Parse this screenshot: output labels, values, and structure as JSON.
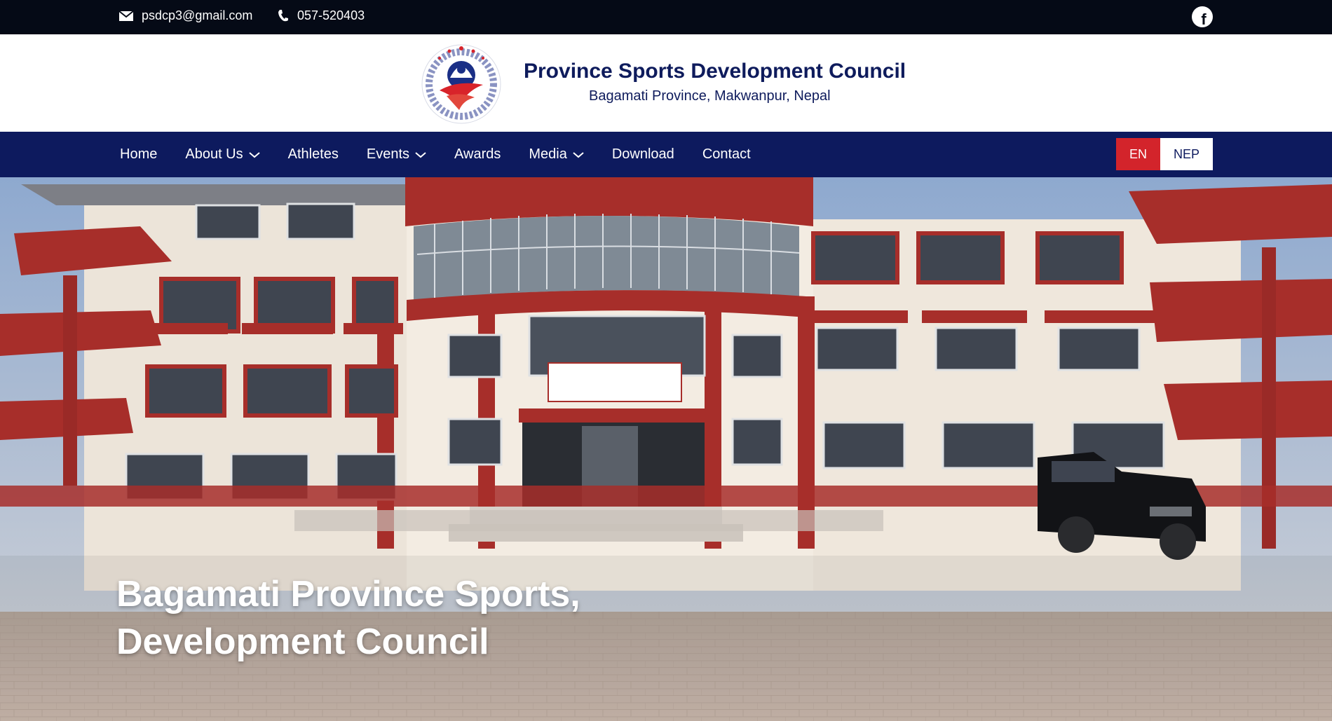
{
  "topbar": {
    "email": "psdcp3@gmail.com",
    "phone": "057-520403",
    "social_icon": "facebook-icon"
  },
  "header": {
    "logo_icon": "council-emblem",
    "title": "Province Sports Development Council",
    "subtitle": "Bagamati Province, Makwanpur, Nepal"
  },
  "nav": {
    "items": [
      {
        "label": "Home",
        "dropdown": false
      },
      {
        "label": "About Us",
        "dropdown": true
      },
      {
        "label": "Athletes",
        "dropdown": false
      },
      {
        "label": "Events",
        "dropdown": true
      },
      {
        "label": "Awards",
        "dropdown": false
      },
      {
        "label": "Media",
        "dropdown": true
      },
      {
        "label": "Download",
        "dropdown": false
      },
      {
        "label": "Contact",
        "dropdown": false
      }
    ],
    "lang": {
      "en": "EN",
      "nep": "NEP",
      "active": "EN"
    }
  },
  "hero": {
    "title_line1": "Bagamati Province Sports,",
    "title_line2": "Development Council"
  },
  "colors": {
    "topbar_bg": "#050a16",
    "nav_bg": "#0d1a5e",
    "title_color": "#0e1b5c",
    "accent_red": "#d3242b"
  }
}
